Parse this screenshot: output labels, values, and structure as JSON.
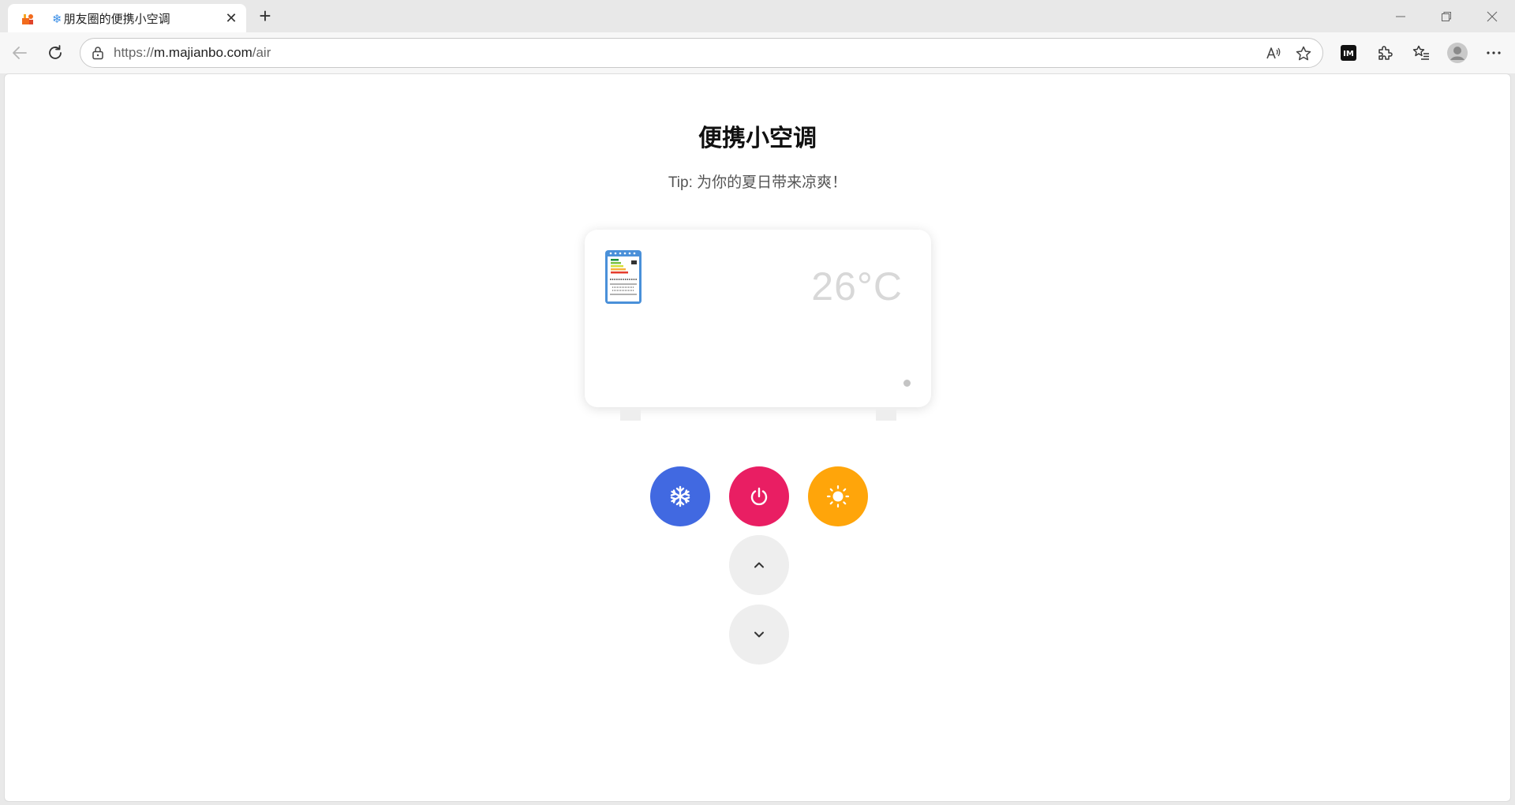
{
  "browser": {
    "tab": {
      "title_icon": "❄",
      "title": "朋友圈的便携小空调",
      "close_label": "✕"
    },
    "new_tab_label": "+",
    "window_controls": {
      "minimize": "—",
      "restore": "❐",
      "close": "✕"
    },
    "url": {
      "protocol": "https://",
      "host": "m.majianbo.com",
      "path": "/air"
    },
    "extension_badge": "IM"
  },
  "page": {
    "title": "便携小空调",
    "tip": "Tip: 为你的夏日带来凉爽！"
  },
  "air_conditioner": {
    "temperature": "26°C",
    "mode_buttons": {
      "cool": "snowflake-icon",
      "power": "power-icon",
      "heat": "sun-icon",
      "up": "chevron-up-icon",
      "down": "chevron-down-icon"
    },
    "colors": {
      "cool": "#4169e1",
      "power": "#e91e63",
      "heat": "#ffa50a",
      "neutral": "#eeeeee"
    }
  }
}
